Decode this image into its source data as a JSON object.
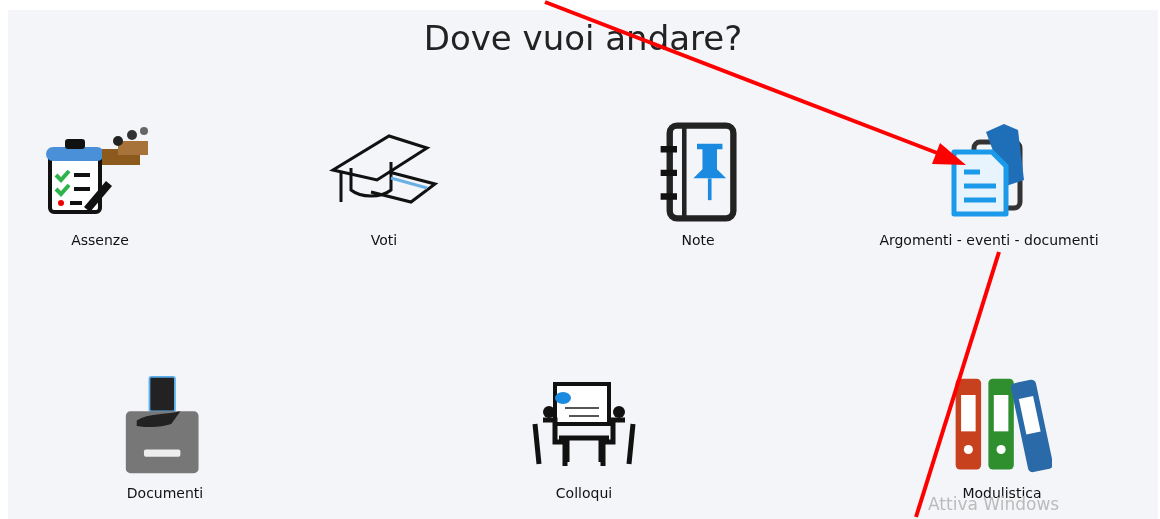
{
  "title": "Dove vuoi andare?",
  "rows": [
    {
      "items": [
        {
          "label": "Assenze"
        },
        {
          "label": "Voti"
        },
        {
          "label": "Note"
        },
        {
          "label": "Argomenti - eventi - documenti"
        }
      ]
    },
    {
      "items": [
        {
          "label": "Documenti"
        },
        {
          "label": "Colloqui"
        },
        {
          "label": "Modulistica"
        }
      ]
    }
  ],
  "overlay_text": "Attiva Windows"
}
